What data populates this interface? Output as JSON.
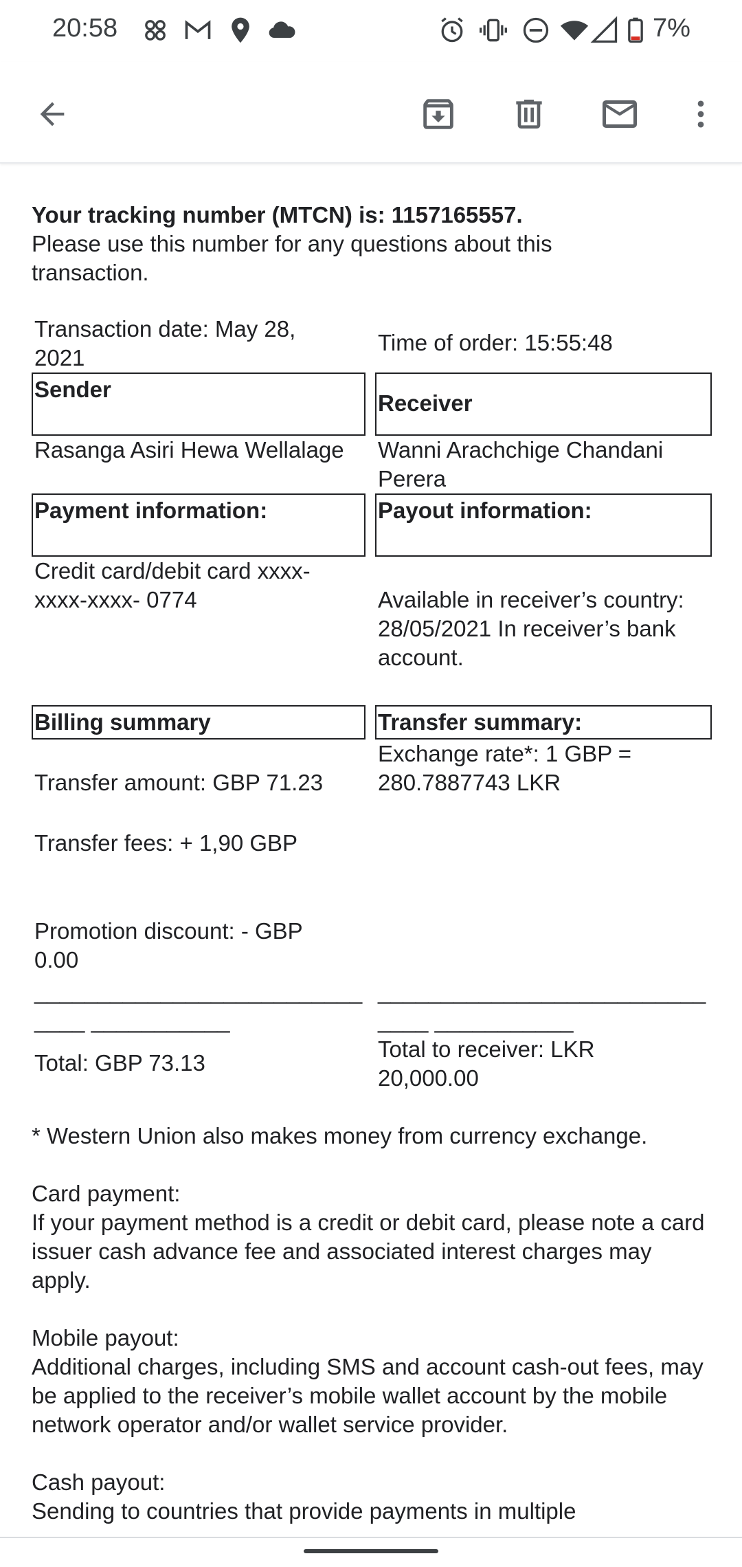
{
  "status_bar": {
    "time": "20:58",
    "battery_percent": "7%",
    "icons": [
      "apps-icon",
      "gmail-icon",
      "location-icon",
      "cloud-icon",
      "alarm-icon",
      "vibrate-icon",
      "dnd-icon",
      "wifi-icon",
      "signal-icon",
      "battery-low-icon"
    ]
  },
  "app_bar": {
    "icons": [
      "back-arrow-icon",
      "archive-icon",
      "delete-icon",
      "mark-unread-icon",
      "more-vert-icon"
    ]
  },
  "email": {
    "tracking_line": "Your tracking number (MTCN) is: 1157165557.",
    "tracking_note": "Please use this number for any questions about this transaction.",
    "transaction_date": "Transaction date: May 28, 2021",
    "time_of_order": "Time of order: 15:55:48",
    "sender_header": "Sender",
    "receiver_header": "Receiver",
    "sender_name": "Rasanga Asiri Hewa Wellalage",
    "receiver_name": "Wanni Arachchige Chandani Perera",
    "payment_header": "Payment information:",
    "payout_header": "Payout information:",
    "payment_detail": "Credit card/debit card xxxx-xxxx-xxxx- 0774",
    "payout_detail": "Available in receiver’s country: 28/05/2021 In receiver’s bank account.",
    "billing_header": "Billing summary",
    "transfer_header": "Transfer summary:",
    "exchange_rate": "Exchange rate*: 1 GBP = 280.7887743 LKR",
    "transfer_amount": "Transfer amount: GBP 71.23",
    "transfer_fees": "Transfer fees: + 1,90 GBP",
    "promotion_discount": "Promotion discount: - GBP 0.00",
    "divider_left": "______________________________ ___________",
    "divider_right": "______________________________ ___________",
    "total": "Total: GBP 73.13",
    "total_receiver": "Total to receiver: LKR 20,000.00",
    "fx_note": "* Western Union also makes money from currency exchange.",
    "card_payment_title": "Card payment:",
    "card_payment_text": "If your payment method is a credit or debit card, please note a card issuer cash advance fee and associated interest charges may apply.",
    "mobile_payout_title": "Mobile payout:",
    "mobile_payout_text": "Additional charges, including SMS and account cash-out fees, may be applied to the receiver’s mobile wallet account by the mobile network operator and/or wallet service provider.",
    "cash_payout_title": "Cash payout:",
    "cash_payout_text": "Sending to countries that provide payments in multiple"
  }
}
